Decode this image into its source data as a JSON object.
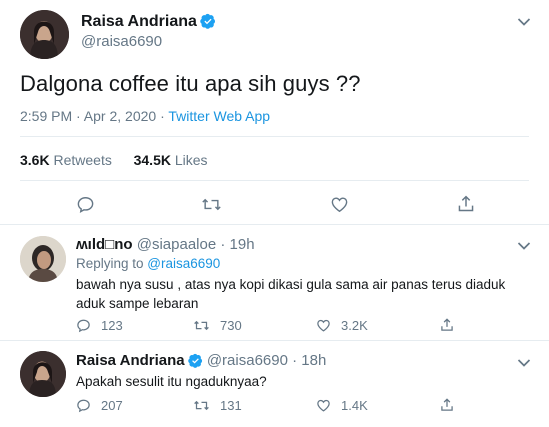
{
  "main_tweet": {
    "author_name": "Raisa Andriana",
    "author_handle": "@raisa6690",
    "text": "Dalgona coffee itu apa sih guys ??",
    "timestamp": "2:59 PM · Apr 2, 2020 · ",
    "source": "Twitter Web App",
    "retweets_count": "3.6K",
    "retweets_label": "Retweets",
    "likes_count": "34.5K",
    "likes_label": "Likes",
    "action_icons": [
      "reply-icon",
      "retweet-icon",
      "like-icon",
      "share-icon"
    ]
  },
  "replies": [
    {
      "author_name": "ʍıld□no",
      "meta": "@siapaaloe · 19h",
      "replying_prefix": "Replying to ",
      "replying_to": "@raisa6690",
      "text": "bawah nya susu , atas nya kopi dikasi gula sama air panas terus diaduk aduk sampe lebaran",
      "reply_count": "123",
      "retweet_count": "730",
      "like_count": "3.2K"
    },
    {
      "author_name": "Raisa Andriana",
      "meta": "@raisa6690 · 18h",
      "text": "Apakah sesulit itu ngaduknyaa?",
      "reply_count": "207",
      "retweet_count": "131",
      "like_count": "1.4K"
    }
  ],
  "colors": {
    "text": "#14171a",
    "secondary": "#657786",
    "link": "#1b95e0",
    "divider": "#e6ecf0",
    "verified": "#1da1f2"
  }
}
